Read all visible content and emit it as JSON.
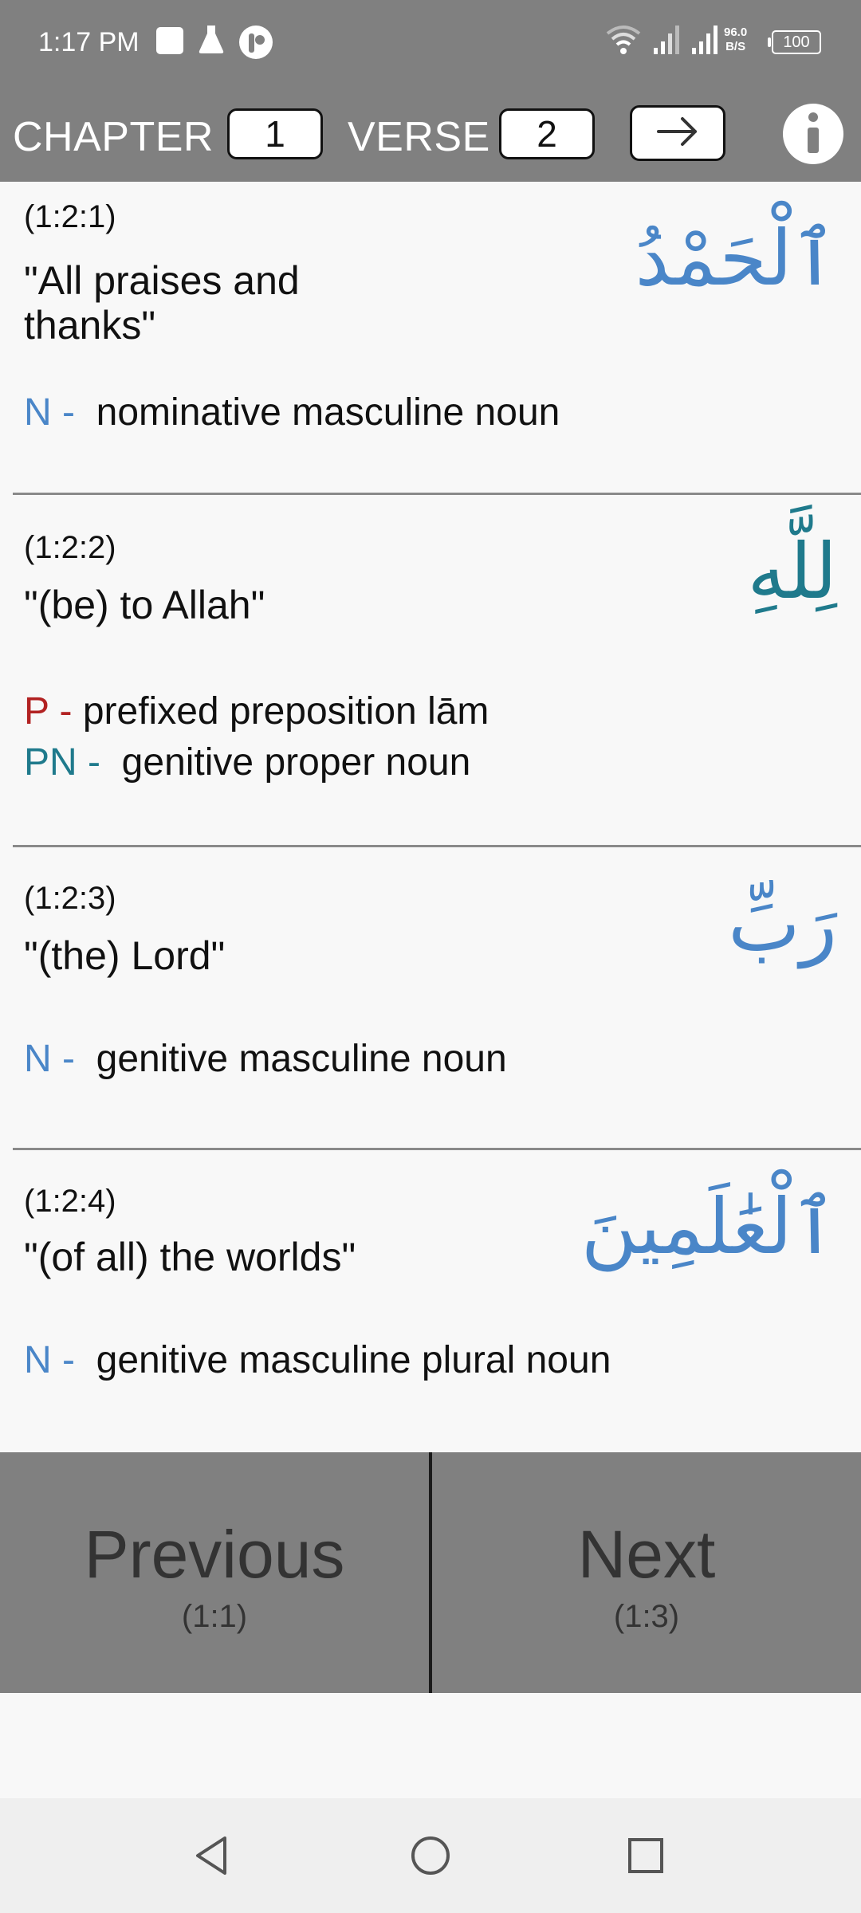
{
  "status_bar": {
    "time": "1:17 PM",
    "net_speed_value": "96.0",
    "net_speed_unit": "B/S",
    "battery": "100",
    "icons": [
      "notification-square-icon",
      "flask-icon",
      "app-circle-icon",
      "wifi-icon",
      "signal-icon",
      "signal-icon"
    ]
  },
  "toolbar": {
    "chapter_label": "CHAPTER",
    "chapter_value": "1",
    "verse_label": "VERSE",
    "verse_value": "2",
    "go_icon": "arrow-right-icon",
    "info_icon": "info-icon"
  },
  "words": [
    {
      "ref": "(1:2:1)",
      "translation": "\"All praises and thanks\"",
      "arabic": "ٱلْحَمْدُ",
      "tags": [
        {
          "code": "N -",
          "desc": "nominative masculine noun",
          "color": "#4a86c8"
        }
      ]
    },
    {
      "ref": "(1:2:2)",
      "translation": "\"(be) to Allah\"",
      "arabic": "لِلَّهِ",
      "tags": [
        {
          "code": "P -",
          "desc": "prefixed preposition lām",
          "color": "#b22222"
        },
        {
          "code": "PN -",
          "desc": "genitive proper noun",
          "color": "#1f7a8c"
        }
      ]
    },
    {
      "ref": "(1:2:3)",
      "translation": "\"(the) Lord\"",
      "arabic": "رَبِّ",
      "tags": [
        {
          "code": "N -",
          "desc": "genitive masculine noun",
          "color": "#4a86c8"
        }
      ]
    },
    {
      "ref": "(1:2:4)",
      "translation": "\"(of all) the worlds\"",
      "arabic": "ٱلْعَٰلَمِينَ",
      "tags": [
        {
          "code": "N -",
          "desc": "genitive masculine plural noun",
          "color": "#4a86c8"
        }
      ]
    }
  ],
  "navigation": {
    "previous_label": "Previous",
    "previous_ref": "(1:1)",
    "next_label": "Next",
    "next_ref": "(1:3)"
  },
  "system_nav": {
    "icons": [
      "back-icon",
      "home-icon",
      "recents-icon"
    ]
  },
  "colors": {
    "bar_bg": "#808080",
    "noun_blue": "#4a86c8",
    "prep_red": "#b22222",
    "proper_teal": "#1f7a8c"
  }
}
